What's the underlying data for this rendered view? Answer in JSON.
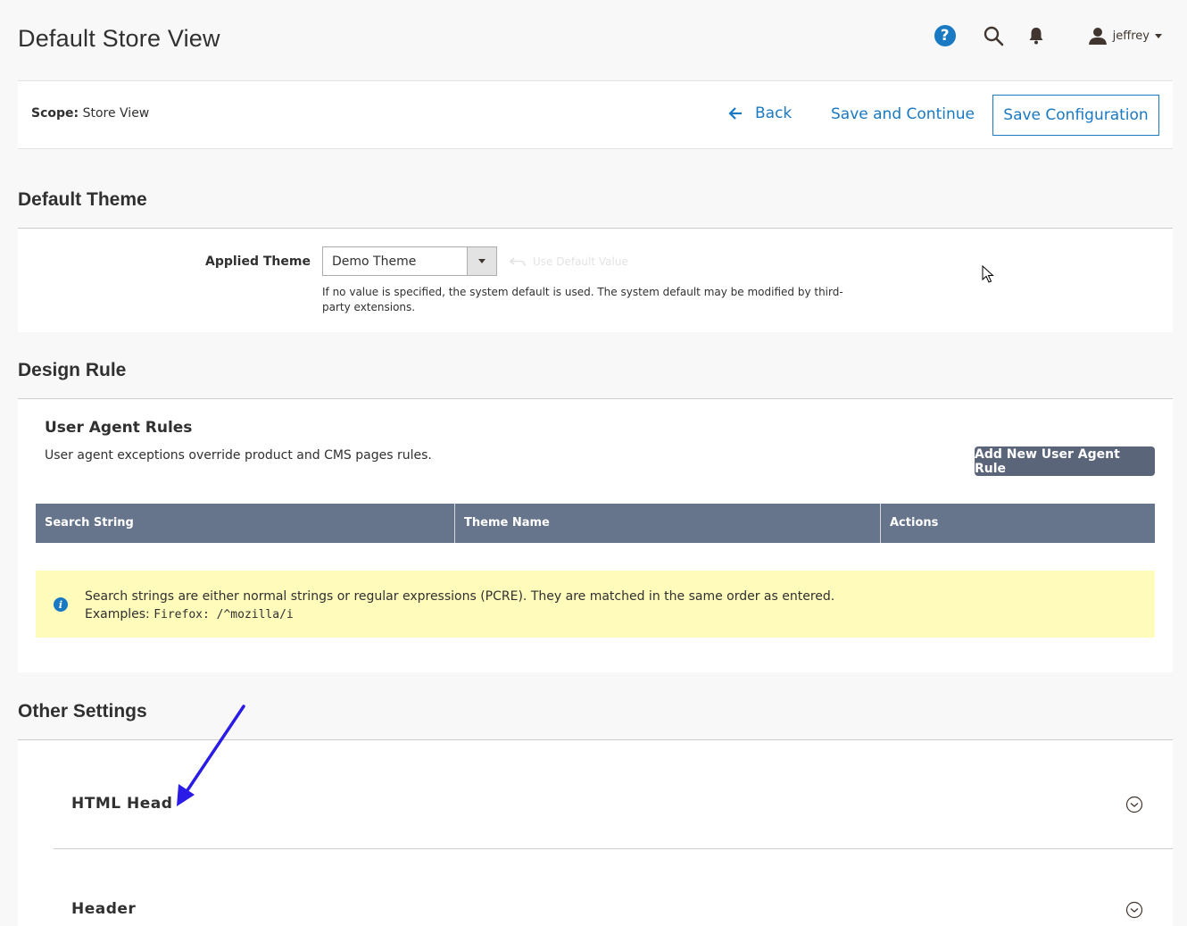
{
  "header": {
    "title": "Default Store View",
    "help_icon": "?",
    "user_name": "jeffrey"
  },
  "scope_bar": {
    "scope_label": "Scope:",
    "scope_value": "Store View",
    "back_label": "Back",
    "save_continue_label": "Save and Continue",
    "save_config_label": "Save Configuration"
  },
  "default_theme": {
    "section_title": "Default Theme",
    "applied_theme_label": "Applied Theme",
    "applied_theme_value": "Demo Theme",
    "use_default_label": "Use Default Value",
    "note": "If no value is specified, the system default is used. The system default may be modified by third-party extensions."
  },
  "design_rule": {
    "section_title": "Design Rule",
    "ua_title": "User Agent Rules",
    "ua_description": "User agent exceptions override product and CMS pages rules.",
    "add_rule_label": "Add New User Agent Rule",
    "columns": [
      "Search String",
      "Theme Name",
      "Actions"
    ],
    "info_icon": "i",
    "info_line1": "Search strings are either normal strings or regular expressions (PCRE). They are matched in the same order as entered.",
    "info_examples_label": "Examples:",
    "info_examples_code": "Firefox: /^mozilla/i"
  },
  "other_settings": {
    "section_title": "Other Settings",
    "groups": [
      {
        "label": "HTML Head"
      },
      {
        "label": "Header"
      }
    ]
  },
  "colors": {
    "accent": "#1979c3",
    "grid_header": "#66748c",
    "info_bg": "#fffbbb",
    "annotation": "#2a1ce6"
  }
}
